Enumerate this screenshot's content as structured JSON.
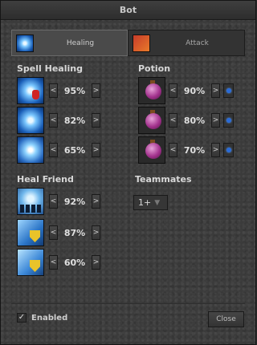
{
  "window": {
    "title": "Bot"
  },
  "tabs": [
    {
      "label": "Healing",
      "icon": "healing-tab-icon",
      "active": true
    },
    {
      "label": "Attack",
      "icon": "attack-tab-icon",
      "active": false
    }
  ],
  "spell_healing": {
    "title": "Spell Healing",
    "rows": [
      {
        "icon": "spell-heal-icon",
        "value": "95%"
      },
      {
        "icon": "spell-heal-icon",
        "value": "82%"
      },
      {
        "icon": "spell-heal-icon",
        "value": "65%"
      }
    ]
  },
  "potion": {
    "title": "Potion",
    "rows": [
      {
        "icon": "potion-icon",
        "value": "90%"
      },
      {
        "icon": "potion-icon",
        "value": "80%"
      },
      {
        "icon": "potion-icon",
        "value": "70%"
      }
    ]
  },
  "heal_friend": {
    "title": "Heal Friend",
    "rows": [
      {
        "icon": "heal-friend-icon",
        "value": "92%"
      },
      {
        "icon": "shield-heal-icon",
        "value": "87%"
      },
      {
        "icon": "shield-heal-icon",
        "value": "60%"
      }
    ]
  },
  "teammates": {
    "title": "Teammates",
    "selected": "1+"
  },
  "arrows": {
    "left": "<",
    "right": ">"
  },
  "footer": {
    "enabled_label": "Enabled",
    "enabled_checked": true,
    "close_label": "Close"
  },
  "colors": {
    "potion_dot": "#2a6bd8",
    "accent_text": "#d8d8d8"
  }
}
